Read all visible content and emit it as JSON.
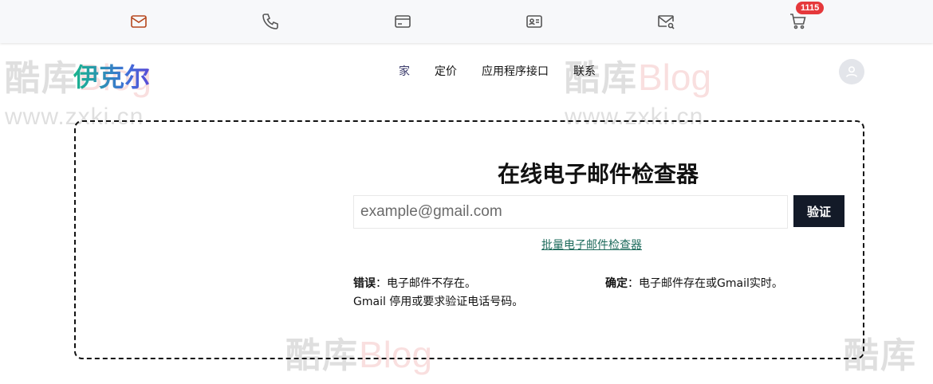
{
  "topbar": {
    "icons": [
      {
        "name": "mail-icon",
        "color": "#b5461c"
      },
      {
        "name": "phone-icon",
        "color": "#555555"
      },
      {
        "name": "credit-card-icon",
        "color": "#555555"
      },
      {
        "name": "id-card-icon",
        "color": "#555555"
      },
      {
        "name": "mail-search-icon",
        "color": "#555555"
      },
      {
        "name": "cart-icon",
        "color": "#555555"
      }
    ],
    "cart_badge": "1115"
  },
  "watermark": {
    "cn": "酷库",
    "blog": "Blog",
    "url": "www.zxki.cn"
  },
  "header": {
    "logo": "伊克尔",
    "nav": [
      "家",
      "定价",
      "应用程序接口",
      "联系"
    ]
  },
  "checker": {
    "title": "在线电子邮件检查器",
    "input_placeholder": "example@gmail.com",
    "input_value": "",
    "verify_label": "验证",
    "bulk_link": "批量电子邮件检查器",
    "error_label": "错误",
    "error_text": "：电子邮件不存在。",
    "error_text2": "Gmail 停用或要求验证电话号码。",
    "ok_label": "确定",
    "ok_text": "：电子邮件存在或Gmail实时。"
  },
  "colors": {
    "accent_dark": "#131a28",
    "link": "#1e6b5c",
    "badge": "#e5383b"
  }
}
